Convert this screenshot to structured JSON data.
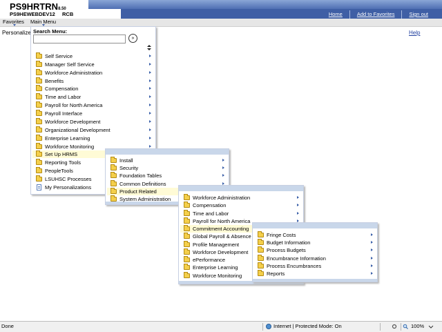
{
  "header": {
    "app_name": "PS9HRTRN",
    "version": "8.50",
    "database": "PS9HEWEBDEV12",
    "user": "RCB",
    "links": [
      "Home",
      "Add to Favorites",
      "Sign out"
    ]
  },
  "menubar": {
    "favorites": "Favorites",
    "main_menu": "Main Menu"
  },
  "page": {
    "personalize": "Personalize",
    "help": "Help"
  },
  "main_menu": {
    "search_label": "Search Menu:",
    "search_value": "",
    "search_button": "»",
    "items": [
      {
        "label": "Self Service",
        "icon": "folder-icon",
        "submenu": true
      },
      {
        "label": "Manager Self Service",
        "icon": "folder-icon",
        "submenu": true
      },
      {
        "label": "Workforce Administration",
        "icon": "folder-icon",
        "submenu": true
      },
      {
        "label": "Benefits",
        "icon": "folder-icon",
        "submenu": true
      },
      {
        "label": "Compensation",
        "icon": "folder-icon",
        "submenu": true
      },
      {
        "label": "Time and Labor",
        "icon": "folder-icon",
        "submenu": true
      },
      {
        "label": "Payroll for North America",
        "icon": "folder-icon",
        "submenu": true
      },
      {
        "label": "Payroll Interface",
        "icon": "folder-icon",
        "submenu": true
      },
      {
        "label": "Workforce Development",
        "icon": "folder-icon",
        "submenu": true
      },
      {
        "label": "Organizational Development",
        "icon": "folder-icon",
        "submenu": true
      },
      {
        "label": "Enterprise Learning",
        "icon": "folder-icon",
        "submenu": true
      },
      {
        "label": "Workforce Monitoring",
        "icon": "folder-icon",
        "submenu": true
      },
      {
        "label": "Set Up HRMS",
        "icon": "folder-icon",
        "submenu": false,
        "selected": true
      },
      {
        "label": "Reporting Tools",
        "icon": "folder-icon",
        "submenu": false
      },
      {
        "label": "PeopleTools",
        "icon": "folder-icon",
        "submenu": false
      },
      {
        "label": "LSUHSC Processes",
        "icon": "folder-icon",
        "submenu": false
      },
      {
        "label": "My Personalizations",
        "icon": "document-icon",
        "submenu": false
      }
    ]
  },
  "setup_hrms_menu": {
    "items": [
      {
        "label": "Install",
        "submenu": true
      },
      {
        "label": "Security",
        "submenu": true
      },
      {
        "label": "Foundation Tables",
        "submenu": true
      },
      {
        "label": "Common Definitions",
        "submenu": true
      },
      {
        "label": "Product Related",
        "submenu": false,
        "selected": true
      },
      {
        "label": "System Administration",
        "submenu": false
      }
    ]
  },
  "product_related_menu": {
    "items": [
      {
        "label": "Workforce Administration",
        "submenu": true
      },
      {
        "label": "Compensation",
        "submenu": true
      },
      {
        "label": "Time and Labor",
        "submenu": true
      },
      {
        "label": "Payroll for North America",
        "submenu": true
      },
      {
        "label": "Commitment Accounting",
        "submenu": false,
        "selected": true
      },
      {
        "label": "Global Payroll & Absence",
        "submenu": false
      },
      {
        "label": "Profile Management",
        "submenu": false
      },
      {
        "label": "Workforce Development",
        "submenu": false
      },
      {
        "label": "ePerformance",
        "submenu": false
      },
      {
        "label": "Enterprise Learning",
        "submenu": false
      },
      {
        "label": "Workforce Monitoring",
        "submenu": false
      }
    ]
  },
  "commitment_accounting_menu": {
    "items": [
      {
        "label": "Fringe Costs",
        "submenu": true
      },
      {
        "label": "Budget Information",
        "submenu": true
      },
      {
        "label": "Process Budgets",
        "submenu": true
      },
      {
        "label": "Encumbrance Information",
        "submenu": true
      },
      {
        "label": "Process Encumbrances",
        "submenu": true
      },
      {
        "label": "Reports",
        "submenu": true
      }
    ]
  },
  "statusbar": {
    "status": "Done",
    "zone": "Internet | Protected Mode: On",
    "zoom": "100%"
  },
  "colors": {
    "header_blue": "#3f5fa5",
    "selected_bg": "#fffbd6",
    "folder_yellow": "#f4cf4b"
  }
}
